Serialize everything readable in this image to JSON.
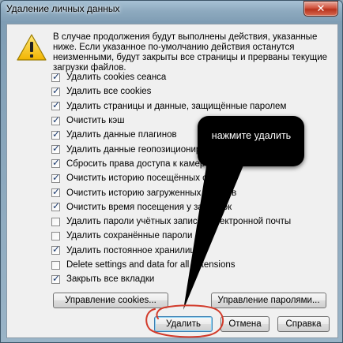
{
  "window": {
    "title": "Удаление личных данных",
    "close_glyph": "✕"
  },
  "message": {
    "text": "В случае продолжения будут выполнены действия, указанные ниже. Если указанное по-умолчанию действия останутся неизменными, будут закрыты все страницы и прерваны текущие загрузки файлов."
  },
  "checkboxes": [
    {
      "label": "Удалить cookies сеанса",
      "checked": true
    },
    {
      "label": "Удалить все cookies",
      "checked": true
    },
    {
      "label": "Удалить страницы и данные, защищённые паролем",
      "checked": true
    },
    {
      "label": "Очистить кэш",
      "checked": true
    },
    {
      "label": "Удалить данные плагинов",
      "checked": true
    },
    {
      "label": "Удалить данные геопозиционирования",
      "checked": true
    },
    {
      "label": "Сбросить права доступа к камере",
      "checked": true
    },
    {
      "label": "Очистить историю посещённых страниц",
      "checked": true
    },
    {
      "label": "Очистить историю загруженных файлов",
      "checked": true
    },
    {
      "label": "Очистить время посещения у закладок",
      "checked": true
    },
    {
      "label": "Удалить пароли учётных записей электронной почты",
      "checked": false
    },
    {
      "label": "Удалить сохранённые пароли",
      "checked": false
    },
    {
      "label": "Удалить постоянное хранилище",
      "checked": true
    },
    {
      "label": "Delete settings and data for all extensions",
      "checked": false
    },
    {
      "label": "Закрыть все вкладки",
      "checked": true
    }
  ],
  "buttons": {
    "manage_cookies": "Управление cookies...",
    "manage_passwords": "Управление паролями...",
    "delete": "Удалить",
    "cancel": "Отмена",
    "help": "Справка"
  },
  "callout": {
    "text": "нажмите удалить"
  },
  "colors": {
    "annotation_red": "#d23b2b",
    "callout_bg": "#000000"
  }
}
